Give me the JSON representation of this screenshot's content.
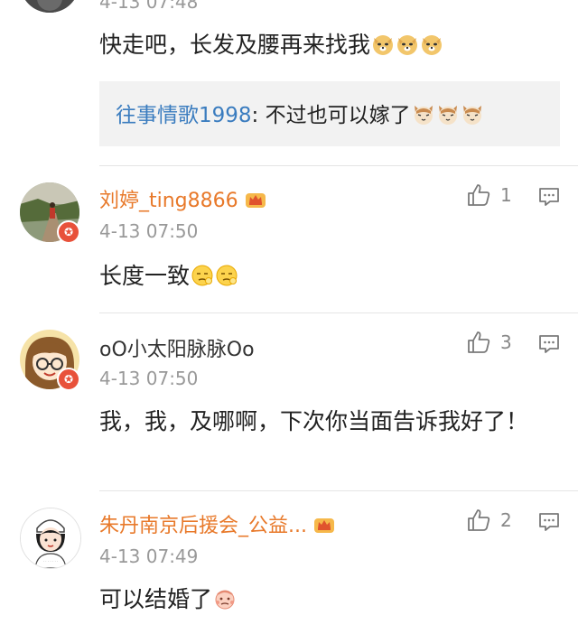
{
  "top_comment": {
    "time": "4-13 07:48",
    "text": "快走吧，长发及腰再来找我",
    "emoji_name": "doge-emoji",
    "reply": {
      "user": "往事情歌1998",
      "separator": ":",
      "text": " 不过也可以嫁了",
      "emoji_name": "cat-emoji"
    }
  },
  "comments": [
    {
      "user": "刘婷_ting8866",
      "time": "4-13 07:50",
      "text": "长度一致",
      "likes": "1",
      "emoji_name": "bored-emoji",
      "vip": true
    },
    {
      "user": "oO小太阳脉脉Oo",
      "time": "4-13 07:50",
      "text": "我，我，及哪啊，下次你当面告诉我好了！",
      "likes": "3",
      "vip": false
    },
    {
      "user": "朱丹南京后援会_公益...",
      "time": "4-13 07:49",
      "text": "可以结婚了",
      "likes": "2",
      "emoji_name": "sick-emoji",
      "vip": true
    }
  ],
  "colors": {
    "username_vip": "#e8792a",
    "username": "#333333",
    "reply_user": "#3a7cbf",
    "timestamp": "#999999",
    "badge": "#e8513a"
  }
}
